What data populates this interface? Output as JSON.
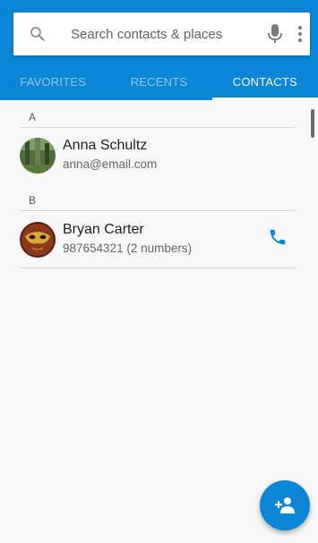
{
  "search": {
    "placeholder": "Search contacts & places"
  },
  "tabs": [
    {
      "label": "FAVORITES",
      "active": false
    },
    {
      "label": "RECENTS",
      "active": false
    },
    {
      "label": "CONTACTS",
      "active": true
    }
  ],
  "sections": [
    {
      "letter": "A",
      "contacts": [
        {
          "name": "Anna Schultz",
          "detail": "anna@email.com",
          "avatar": "forest-photo",
          "has_call": false
        }
      ]
    },
    {
      "letter": "B",
      "contacts": [
        {
          "name": "Bryan Carter",
          "detail": "987654321 (2 numbers)",
          "avatar": "masquerade-mask-photo",
          "has_call": true
        }
      ]
    }
  ],
  "icons": {
    "search": "search-icon",
    "mic": "microphone-icon",
    "more": "more-vert-icon",
    "call": "phone-icon",
    "add_contact": "person-add-icon"
  },
  "colors": {
    "accent": "#0b86d6",
    "tab_inactive": "#9fd0f0",
    "tab_active": "#ffffff"
  }
}
